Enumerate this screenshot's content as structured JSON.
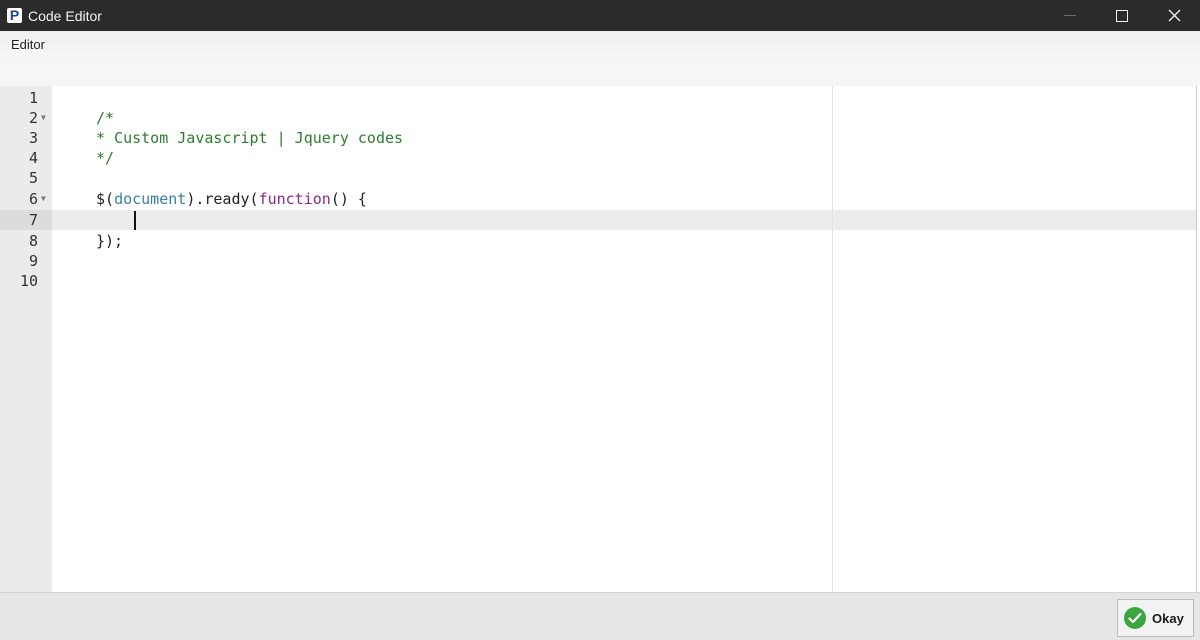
{
  "window": {
    "title": "Code Editor",
    "logo_letter": "P"
  },
  "tabs": {
    "active_label": "Editor"
  },
  "editor": {
    "cursor_line": 7,
    "lines": [
      {
        "number": "1",
        "text": ""
      },
      {
        "number": "2",
        "text": "/*"
      },
      {
        "number": "3",
        "text": "* Custom Javascript | Jquery codes"
      },
      {
        "number": "4",
        "text": "*/"
      },
      {
        "number": "5",
        "text": ""
      },
      {
        "number": "6",
        "text": "$(document).ready(function() {"
      },
      {
        "number": "7",
        "text": ""
      },
      {
        "number": "8",
        "text": "});"
      },
      {
        "number": "9",
        "text": ""
      },
      {
        "number": "10",
        "text": ""
      }
    ],
    "tokens": {
      "line6_dollar": "$(",
      "line6_document": "document",
      "line6_ready": ").ready(",
      "line6_function": "function",
      "line6_rest": "() {"
    }
  },
  "footer": {
    "okay_label": "Okay"
  },
  "colors": {
    "titlebar": "#2b2b2b",
    "comment": "#2e7d32",
    "keyword": "#8a2a8a",
    "variable": "#3a7ea8",
    "ok_icon": "#3aa640"
  },
  "icons": {
    "logo": "app-logo-icon",
    "minimize": "minimize-icon",
    "maximize": "maximize-icon",
    "close": "close-icon",
    "okay": "check-circle-icon"
  }
}
